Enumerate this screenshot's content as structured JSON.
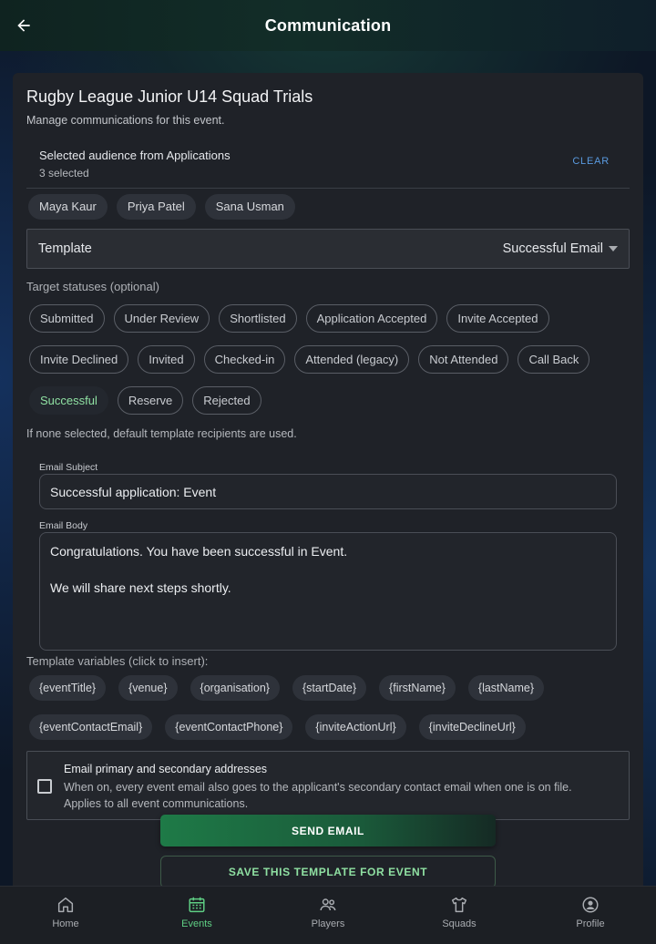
{
  "header": {
    "title": "Communication"
  },
  "event": {
    "title": "Rugby League Junior U14 Squad Trials",
    "description": "Manage communications for this event."
  },
  "audience": {
    "label": "Selected audience from Applications",
    "count": "3 selected",
    "clear_label": "CLEAR",
    "names": [
      "Maya Kaur",
      "Priya Patel",
      "Sana Usman"
    ]
  },
  "template": {
    "label": "Template",
    "value": "Successful Email"
  },
  "statuses": {
    "label": "Target statuses (optional)",
    "items": [
      "Submitted",
      "Under Review",
      "Shortlisted",
      "Application Accepted",
      "Invite Accepted",
      "Invite Declined",
      "Invited",
      "Checked-in",
      "Attended (legacy)",
      "Not Attended",
      "Call Back",
      "Successful",
      "Reserve",
      "Rejected"
    ],
    "selected": "Successful",
    "hint": "If none selected, default template recipients are used."
  },
  "email": {
    "subject_label": "Email Subject",
    "subject_value": "Successful application: Event",
    "body_label": "Email Body",
    "body_value": "Congratulations. You have been successful in Event.\n\nWe will share next steps shortly."
  },
  "variables": {
    "label": "Template variables (click to insert):",
    "items": [
      "{eventTitle}",
      "{venue}",
      "{organisation}",
      "{startDate}",
      "{firstName}",
      "{lastName}",
      "{eventContactEmail}",
      "{eventContactPhone}",
      "{inviteActionUrl}",
      "{inviteDeclineUrl}"
    ]
  },
  "secondary_email": {
    "title": "Email primary and secondary addresses",
    "description": "When on, every event email also goes to the applicant's secondary contact email when one is on file. Applies to all event communications.",
    "checked": false
  },
  "actions": {
    "send_label": "SEND EMAIL",
    "save_label": "SAVE THIS TEMPLATE FOR EVENT"
  },
  "nav": {
    "items": [
      {
        "label": "Home",
        "icon": "home-icon"
      },
      {
        "label": "Events",
        "icon": "calendar-icon"
      },
      {
        "label": "Players",
        "icon": "people-icon"
      },
      {
        "label": "Squads",
        "icon": "shirt-icon"
      },
      {
        "label": "Profile",
        "icon": "profile-icon"
      }
    ],
    "active": "Events"
  },
  "colors": {
    "accent_green": "#5fcf84",
    "link_blue": "#5a9be0",
    "card_bg": "#1f2228"
  }
}
